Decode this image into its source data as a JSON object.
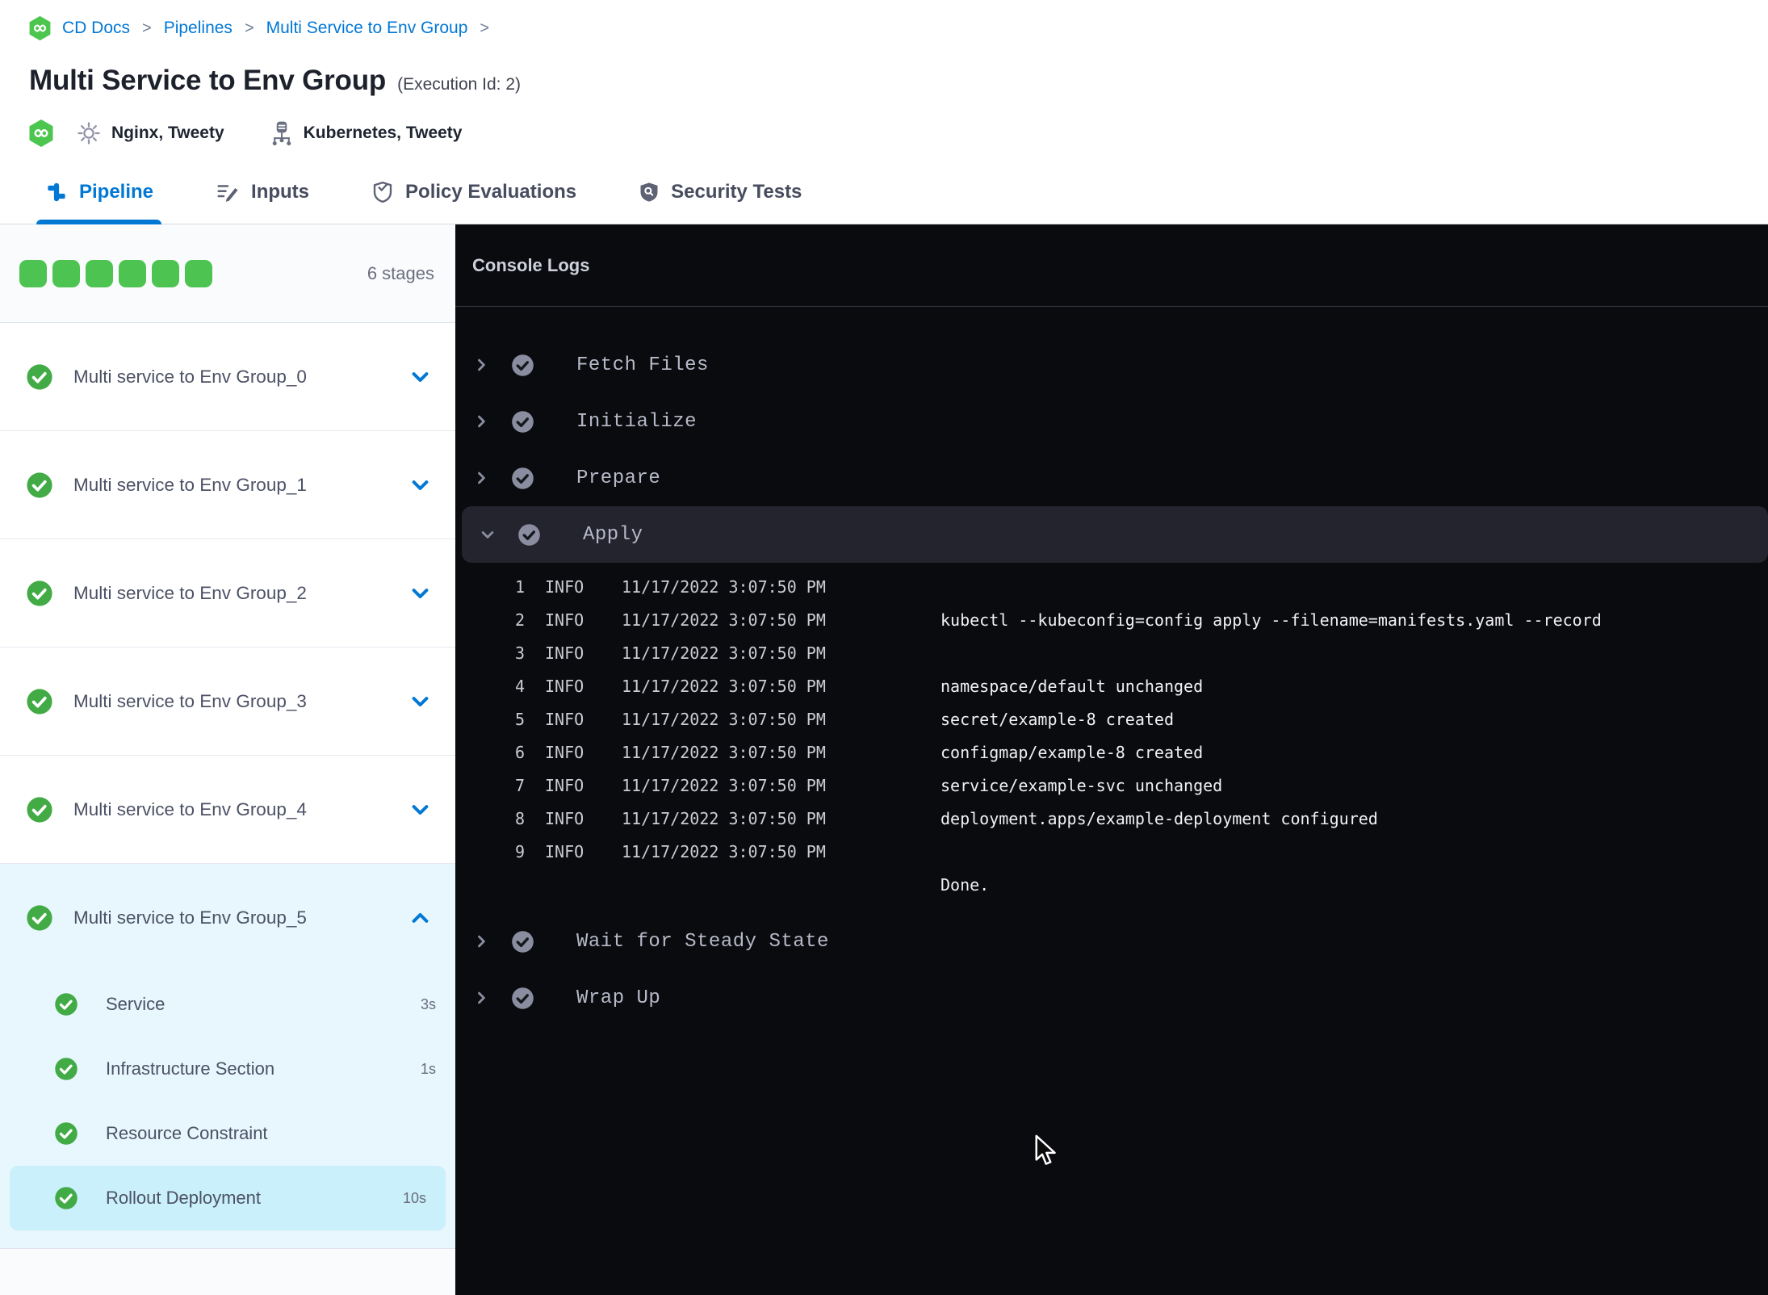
{
  "breadcrumb": {
    "items": [
      "CD Docs",
      "Pipelines",
      "Multi Service to Env Group"
    ],
    "separator": ">"
  },
  "header": {
    "title": "Multi Service to Env Group",
    "execution_id": "(Execution Id: 2)",
    "services_label": "Nginx, Tweety",
    "infrastructure_label": "Kubernetes, Tweety"
  },
  "tabs": [
    {
      "label": "Pipeline",
      "icon": "pipeline-icon",
      "active": true
    },
    {
      "label": "Inputs",
      "icon": "inputs-icon",
      "active": false
    },
    {
      "label": "Policy Evaluations",
      "icon": "policy-evaluations-icon",
      "active": false
    },
    {
      "label": "Security Tests",
      "icon": "security-tests-icon",
      "active": false
    }
  ],
  "sidebar": {
    "stage_square_count": 6,
    "stage_count_label": "6 stages",
    "collapsed_stages": [
      {
        "label": "Multi service to Env Group_0"
      },
      {
        "label": "Multi service to Env Group_1"
      },
      {
        "label": "Multi service to Env Group_2"
      },
      {
        "label": "Multi service to Env Group_3"
      },
      {
        "label": "Multi service to Env Group_4"
      }
    ],
    "expanded_stage": {
      "label": "Multi service to Env Group_5",
      "steps": [
        {
          "label": "Service",
          "duration": "3s",
          "selected": false
        },
        {
          "label": "Infrastructure Section",
          "duration": "1s",
          "selected": false
        },
        {
          "label": "Resource Constraint",
          "duration": "",
          "selected": false
        },
        {
          "label": "Rollout Deployment",
          "duration": "10s",
          "selected": true
        }
      ]
    }
  },
  "console": {
    "title": "Console Logs",
    "steps": [
      {
        "label": "Fetch Files",
        "expanded": false
      },
      {
        "label": "Initialize",
        "expanded": false
      },
      {
        "label": "Prepare",
        "expanded": false
      },
      {
        "label": "Apply",
        "expanded": true,
        "logs": [
          {
            "num": "1",
            "level": "INFO",
            "time": "11/17/2022 3:07:50 PM",
            "message": ""
          },
          {
            "num": "2",
            "level": "INFO",
            "time": "11/17/2022 3:07:50 PM",
            "message": "kubectl --kubeconfig=config apply --filename=manifests.yaml --record"
          },
          {
            "num": "3",
            "level": "INFO",
            "time": "11/17/2022 3:07:50 PM",
            "message": ""
          },
          {
            "num": "4",
            "level": "INFO",
            "time": "11/17/2022 3:07:50 PM",
            "message": "namespace/default unchanged"
          },
          {
            "num": "5",
            "level": "INFO",
            "time": "11/17/2022 3:07:50 PM",
            "message": "secret/example-8 created"
          },
          {
            "num": "6",
            "level": "INFO",
            "time": "11/17/2022 3:07:50 PM",
            "message": "configmap/example-8 created"
          },
          {
            "num": "7",
            "level": "INFO",
            "time": "11/17/2022 3:07:50 PM",
            "message": "service/example-svc unchanged"
          },
          {
            "num": "8",
            "level": "INFO",
            "time": "11/17/2022 3:07:50 PM",
            "message": "deployment.apps/example-deployment configured"
          },
          {
            "num": "9",
            "level": "INFO",
            "time": "11/17/2022 3:07:50 PM",
            "message": ""
          },
          {
            "num": "",
            "level": "",
            "time": "",
            "message": "Done."
          }
        ]
      },
      {
        "label": "Wait for Steady State",
        "expanded": false
      },
      {
        "label": "Wrap Up",
        "expanded": false
      }
    ]
  },
  "colors": {
    "accent_blue": "#0278d5",
    "success_green": "#42ab45",
    "stage_square_green": "#4dc452",
    "console_background": "#0a0b0e",
    "console_step_highlight": "#23242d",
    "expanded_stage_background": "#e7f7fd",
    "selected_step_background": "#c9f0fb"
  }
}
